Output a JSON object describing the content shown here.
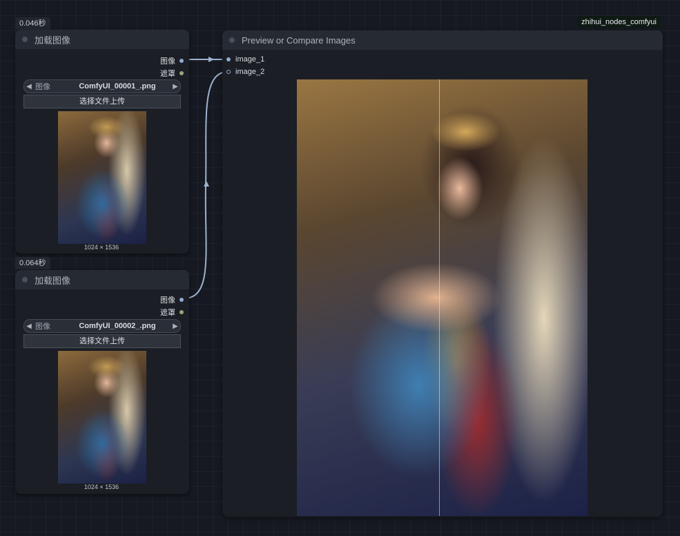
{
  "canvas": {
    "badge_label": "zhihui_nodes_comfyui"
  },
  "load_nodes": [
    {
      "timing": "0.046秒",
      "title": "加载图像",
      "outputs": [
        "图像",
        "遮罩"
      ],
      "combo_label": "图像",
      "filename": "ComfyUI_00001_.png",
      "upload_label": "选择文件上传",
      "dimensions": "1024 × 1536"
    },
    {
      "timing": "0.064秒",
      "title": "加载图像",
      "outputs": [
        "图像",
        "遮罩"
      ],
      "combo_label": "图像",
      "filename": "ComfyUI_00002_.png",
      "upload_label": "选择文件上传",
      "dimensions": "1024 × 1536"
    }
  ],
  "preview_node": {
    "title": "Preview or Compare Images",
    "inputs": [
      "image_1",
      "image_2"
    ],
    "compare_split": 0.49
  },
  "icons": {
    "prev": "◀",
    "next": "▶"
  },
  "colors": {
    "image_slot": "#8faad0",
    "mask_slot": "#9ba67a",
    "link": "#9fb3cf"
  }
}
